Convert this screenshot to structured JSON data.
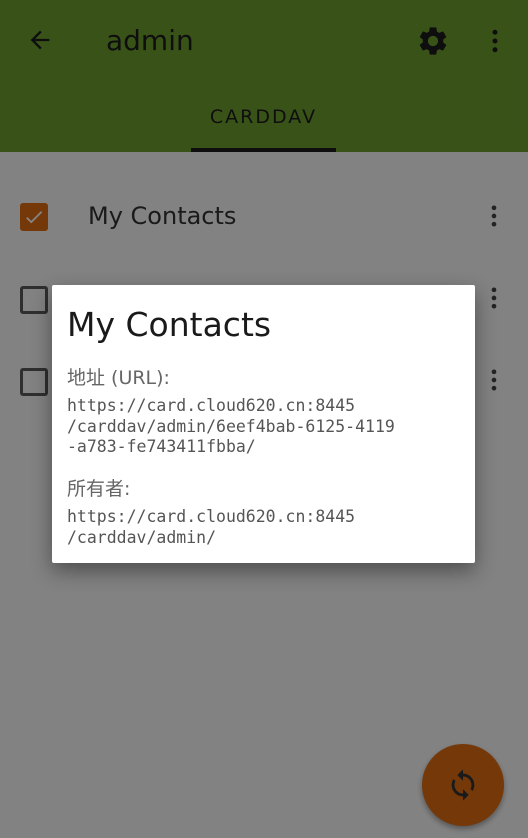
{
  "appbar": {
    "title": "admin",
    "back_icon": "arrow-back-icon",
    "settings_icon": "gear-icon",
    "more_icon": "more-vert-icon",
    "tab_label": "CARDDAV",
    "color": "#6d9e2f"
  },
  "list": {
    "items": [
      {
        "label": "My Contacts",
        "checked": true
      },
      {
        "label": "",
        "checked": false
      },
      {
        "label": "",
        "checked": false
      }
    ]
  },
  "fab": {
    "icon": "sync-icon",
    "color": "#e06b10"
  },
  "dialog": {
    "title": "My Contacts",
    "url_label": "地址 (URL):",
    "url_value": "https://card.cloud620.cn:8445\n/carddav/admin/6eef4bab-6125-4119\n-a783-fe743411fbba/",
    "owner_label": "所有者:",
    "owner_value": "https://card.cloud620.cn:8445\n/carddav/admin/"
  }
}
